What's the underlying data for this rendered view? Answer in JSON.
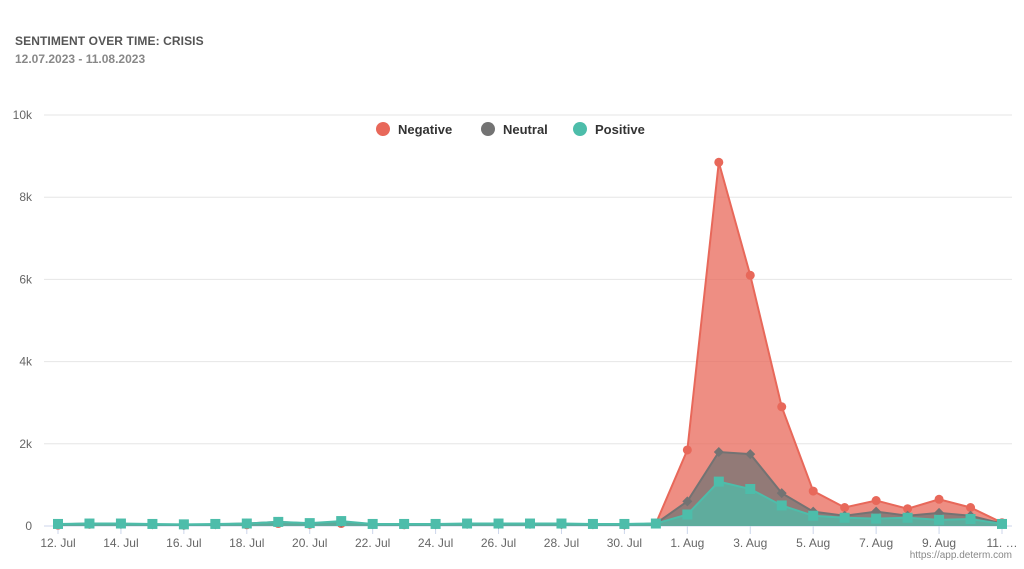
{
  "header": {
    "title": "SENTIMENT OVER TIME: CRISIS",
    "date_range": "12.07.2023 - 11.08.2023"
  },
  "credit": "https://app.determ.com",
  "chart_data": {
    "type": "area",
    "title": "SENTIMENT OVER TIME: CRISIS",
    "subtitle": "12.07.2023 - 11.08.2023",
    "xlabel": "",
    "ylabel": "",
    "ylim": [
      0,
      10000
    ],
    "yticks": [
      0,
      2000,
      4000,
      6000,
      8000,
      10000
    ],
    "ytick_labels": [
      "0",
      "2k",
      "4k",
      "6k",
      "8k",
      "10k"
    ],
    "grid": true,
    "legend_position": "top-center",
    "x": [
      "12. Jul",
      "13. Jul",
      "14. Jul",
      "15. Jul",
      "16. Jul",
      "17. Jul",
      "18. Jul",
      "19. Jul",
      "20. Jul",
      "21. Jul",
      "22. Jul",
      "23. Jul",
      "24. Jul",
      "25. Jul",
      "26. Jul",
      "27. Jul",
      "28. Jul",
      "29. Jul",
      "30. Jul",
      "31. Jul",
      "1. Aug",
      "2. Aug",
      "3. Aug",
      "4. Aug",
      "5. Aug",
      "6. Aug",
      "7. Aug",
      "8. Aug",
      "9. Aug",
      "10. Aug",
      "11. Aug"
    ],
    "xtick_labels": [
      "12. Jul",
      "14. Jul",
      "16. Jul",
      "18. Jul",
      "20. Jul",
      "22. Jul",
      "24. Jul",
      "26. Jul",
      "28. Jul",
      "30. Jul",
      "1. Aug",
      "3. Aug",
      "5. Aug",
      "7. Aug",
      "9. Aug",
      "11. …"
    ],
    "series": [
      {
        "name": "Negative",
        "color": "#e8685a",
        "marker": "circle",
        "values": [
          20,
          40,
          50,
          40,
          20,
          40,
          30,
          60,
          40,
          60,
          40,
          30,
          40,
          50,
          60,
          50,
          40,
          40,
          30,
          60,
          1850,
          8850,
          6100,
          2900,
          850,
          450,
          620,
          420,
          650,
          450,
          80
        ]
      },
      {
        "name": "Neutral",
        "color": "#737373",
        "marker": "diamond",
        "values": [
          40,
          60,
          50,
          40,
          20,
          40,
          60,
          100,
          60,
          90,
          50,
          40,
          40,
          50,
          50,
          50,
          50,
          40,
          30,
          60,
          600,
          1800,
          1750,
          800,
          350,
          250,
          350,
          250,
          320,
          250,
          60
        ]
      },
      {
        "name": "Positive",
        "color": "#4dbdaa",
        "marker": "square",
        "values": [
          50,
          60,
          60,
          50,
          40,
          50,
          60,
          100,
          70,
          120,
          50,
          50,
          50,
          60,
          60,
          60,
          60,
          50,
          50,
          60,
          280,
          1080,
          900,
          500,
          250,
          200,
          180,
          200,
          150,
          170,
          50
        ]
      }
    ]
  }
}
